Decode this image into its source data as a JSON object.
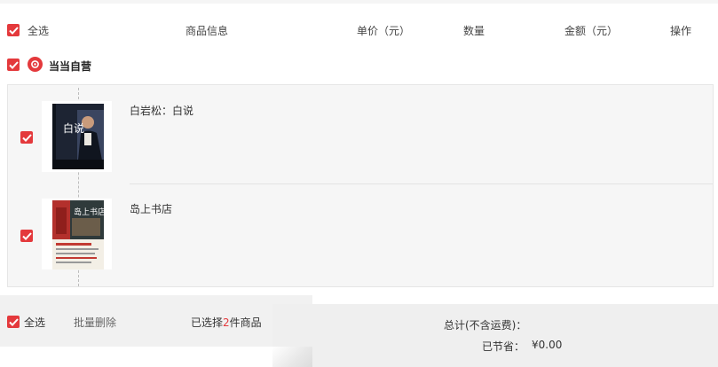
{
  "header": {
    "select_all": "全选",
    "product_info": "商品信息",
    "unit_price": "单价（元）",
    "quantity": "数量",
    "amount": "金额（元）",
    "action": "操作"
  },
  "shop": {
    "name": "当当自营"
  },
  "items": [
    {
      "title": "白岩松：白说",
      "cover_text": "白说",
      "checked": true
    },
    {
      "title": "岛上书店",
      "cover_text": "岛上书店",
      "checked": true
    }
  ],
  "footer": {
    "select_all": "全选",
    "batch_delete": "批量删除",
    "selected_prefix": "已选择",
    "selected_count": "2",
    "selected_suffix": "件商品",
    "total_label": "总计(不含运费)：",
    "saved_label": "已节省：",
    "saved_value": "¥0.00"
  },
  "colors": {
    "accent": "#e4393c"
  }
}
